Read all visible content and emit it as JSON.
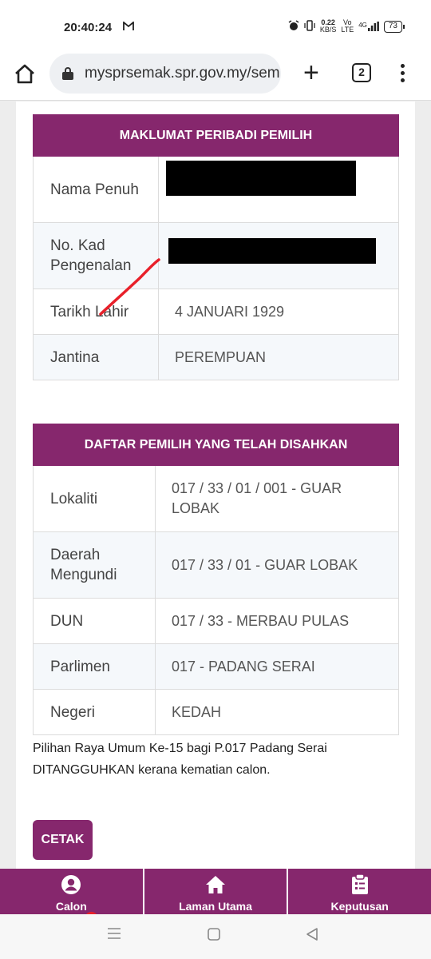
{
  "status_bar": {
    "time": "20:40:24",
    "mail_icon": "gmail-icon",
    "net_speed_top": "0.22",
    "net_speed_bottom": "KB/S",
    "volte_top": "Vo",
    "volte_bottom": "LTE",
    "network": "4G",
    "battery": "73"
  },
  "browser": {
    "url": "mysprsemak.spr.gov.my/sem",
    "tab_count": "2"
  },
  "personal": {
    "header": "MAKLUMAT PERIBADI PEMILIH",
    "rows": [
      {
        "label": "Nama Penuh",
        "value": ""
      },
      {
        "label": "No. Kad Pengenalan",
        "value": ""
      },
      {
        "label": "Tarikh Lahir",
        "value": "4 JANUARI 1929"
      },
      {
        "label": "Jantina",
        "value": "PEREMPUAN"
      }
    ]
  },
  "voter": {
    "header": "DAFTAR PEMILIH YANG TELAH DISAHKAN",
    "rows": [
      {
        "label": "Lokaliti",
        "value": "017 / 33 / 01 / 001 - GUAR LOBAK"
      },
      {
        "label": "Daerah Mengundi",
        "value": "017 / 33 / 01 - GUAR LOBAK"
      },
      {
        "label": "DUN",
        "value": "017 / 33 - MERBAU PULAS"
      },
      {
        "label": "Parlimen",
        "value": "017 - PADANG SERAI"
      },
      {
        "label": "Negeri",
        "value": "KEDAH"
      }
    ]
  },
  "note": "Pilihan Raya Umum Ke-15 bagi P.017 Padang Serai DITANGGUHKAN kerana kematian calon.",
  "cetak_label": "CETAK",
  "bottom_nav": [
    {
      "label": "Calon",
      "icon": "user-circle-icon"
    },
    {
      "label": "Laman Utama",
      "icon": "home-icon"
    },
    {
      "label": "Keputusan",
      "icon": "clipboard-icon"
    }
  ],
  "colors": {
    "accent": "#86276d",
    "annotation": "#e8202a"
  }
}
